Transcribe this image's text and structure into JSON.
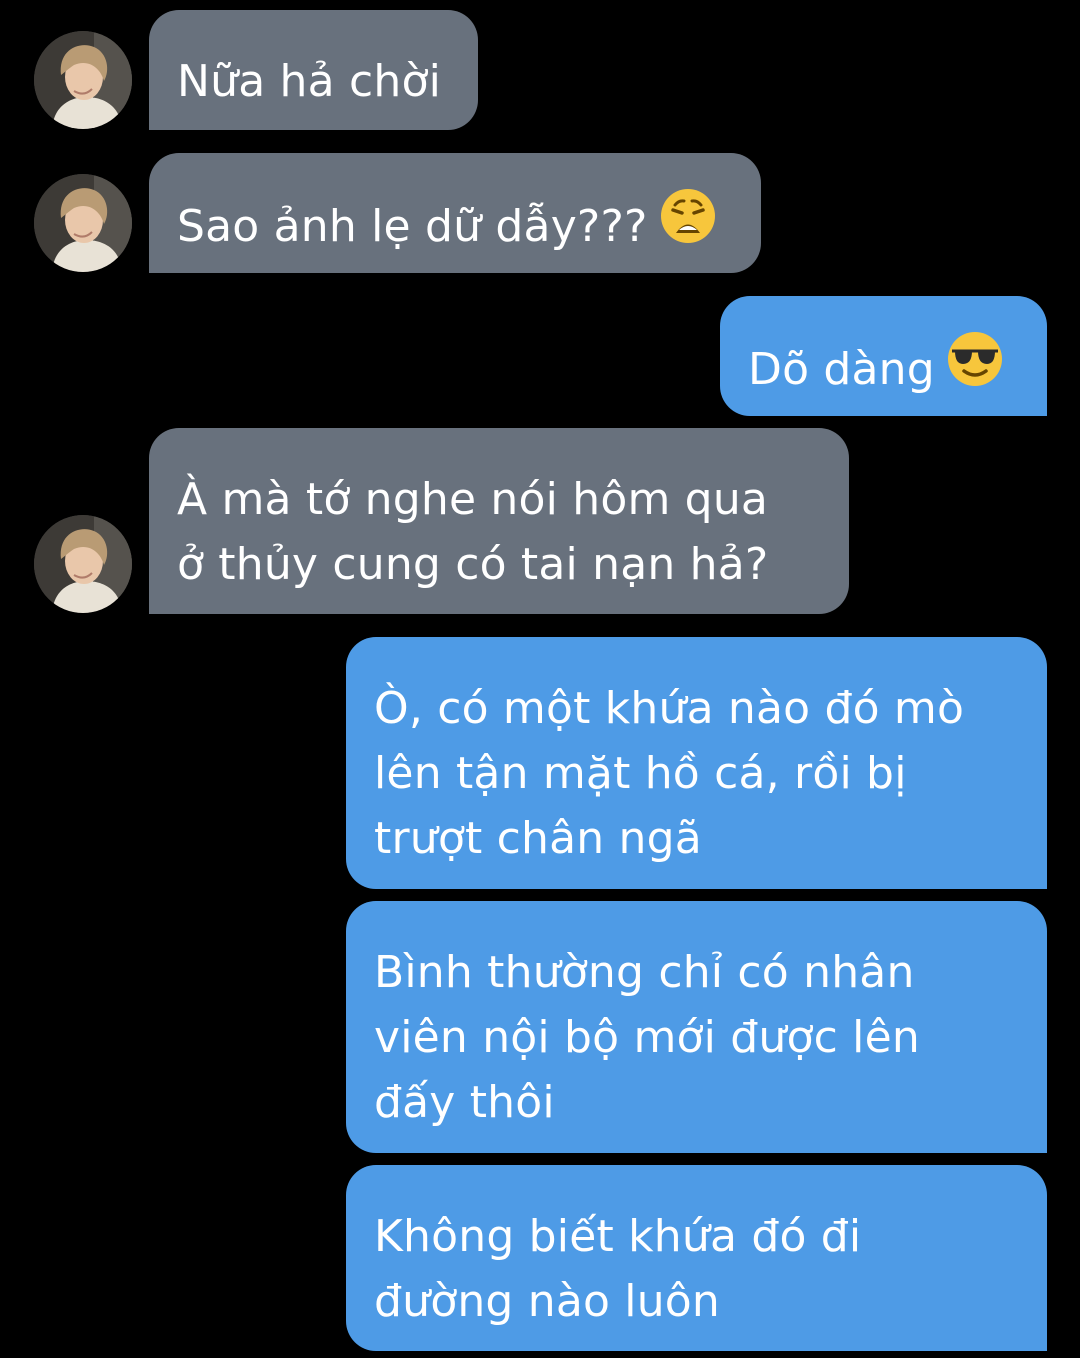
{
  "conversation": {
    "messages": [
      {
        "sender": "them",
        "lines": [
          "Nữa hả chời"
        ]
      },
      {
        "sender": "them",
        "lines": [
          "Sao ảnh lẹ dữ dẫy???"
        ],
        "emoji": "weary-face-emoji"
      },
      {
        "sender": "me",
        "lines": [
          "Dõ dàng"
        ],
        "emoji": "sunglasses-face-emoji"
      },
      {
        "sender": "them",
        "lines": [
          "À mà tớ nghe nói hôm qua",
          "ở thủy cung có tai nạn hả?"
        ]
      },
      {
        "sender": "me",
        "lines": [
          "Ò, có một khứa nào đó mò",
          "lên tận mặt hồ cá, rồi bị",
          "trượt chân ngã"
        ]
      },
      {
        "sender": "me",
        "lines": [
          "Bình thường chỉ có nhân",
          "viên nội bộ mới được lên",
          "đấy thôi"
        ]
      },
      {
        "sender": "me",
        "lines": [
          "Không biết khứa đó đi",
          "đường nào luôn"
        ]
      }
    ]
  },
  "colors": {
    "background": "#000000",
    "incoming_bubble": "#68717d",
    "outgoing_bubble": "#4e9be6",
    "text": "#ffffff"
  }
}
